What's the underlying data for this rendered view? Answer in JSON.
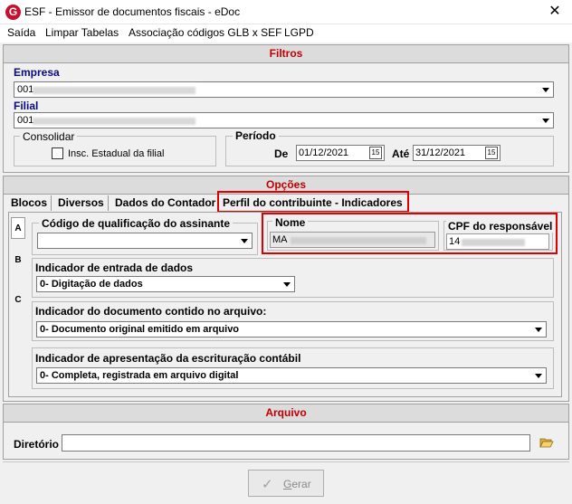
{
  "window": {
    "title": "ESF - Emissor de documentos fiscais - eDoc",
    "close_symbol": "✕",
    "app_icon": "G"
  },
  "menu": [
    "Saída",
    "Limpar Tabelas",
    "Associação códigos GLB x SEF",
    "LGPD"
  ],
  "filtros": {
    "header": "Filtros",
    "empresa_label": "Empresa",
    "empresa_value": "001",
    "filial_label": "Filial",
    "filial_value": "001",
    "consolidar_label": "Consolidar",
    "insc_label": "Insc. Estadual da filial",
    "periodo_label": "Período",
    "de_label": "De",
    "de_value": "01/12/2021",
    "ate_label": "Até",
    "ate_value": "31/12/2021",
    "calendar_glyph": "15"
  },
  "opcoes": {
    "header": "Opções",
    "tabs": [
      "Blocos",
      "Diversos",
      "Dados do Contador",
      "Perfil do contribuinte - Indicadores"
    ],
    "side_tabs": [
      "A",
      "B",
      "C"
    ],
    "codigo_label": "Código de qualificação do assinante",
    "nome_label": "Nome",
    "nome_value": "MA",
    "cpf_label": "CPF do responsável",
    "cpf_value": "14",
    "entrada_label": "Indicador de entrada de dados",
    "entrada_value": "0- Digitação de dados",
    "documento_label": "Indicador do documento contido no arquivo:",
    "documento_value": "0- Documento original emitido em arquivo",
    "apresentacao_label": "Indicador de apresentação da escrituração contábil",
    "apresentacao_value": "0- Completa, registrada em arquivo digital"
  },
  "arquivo": {
    "header": "Arquivo",
    "diretorio_label": "Diretório",
    "diretorio_value": ""
  },
  "gerar_button": {
    "check": "✓",
    "label_underlined": "G",
    "label_rest": "erar"
  },
  "colors": {
    "section_header_text": "#c00000",
    "label_blue": "#0a0a80",
    "highlight": "#e00000"
  }
}
